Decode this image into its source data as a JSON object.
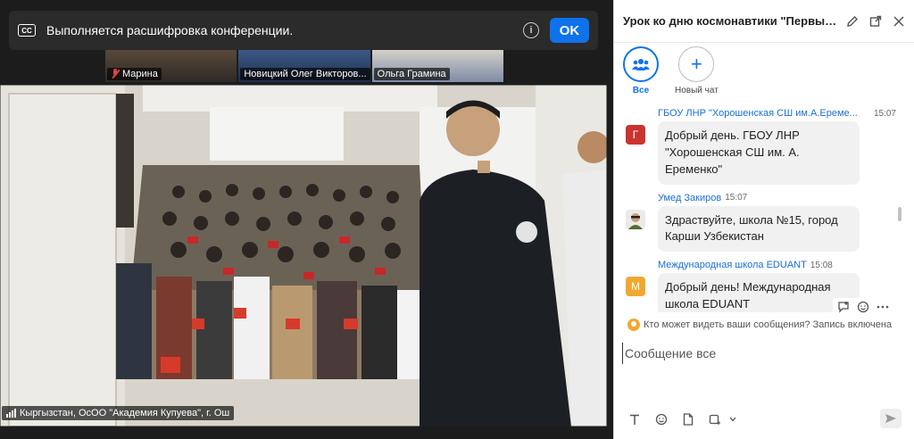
{
  "banner": {
    "text": "Выполняется расшифровка конференции.",
    "ok_label": "OK",
    "cc_label": "CC"
  },
  "thumbnails": [
    {
      "name": "Марина",
      "muted": true
    },
    {
      "name": "Новицкий Олег Викторов...",
      "muted": false
    },
    {
      "name": "Ольга Грамина",
      "muted": false
    }
  ],
  "video": {
    "label": "Кыргызстан, ОсОО \"Академия Купуева\", г. Ош"
  },
  "chat": {
    "title": "Урок ко дню космонавтики \"Первые в...",
    "tabs": [
      {
        "label": "Все",
        "active": true
      },
      {
        "label": "Новый чат",
        "active": false
      }
    ],
    "messages": [
      {
        "sender": "ГБОУ ЛНР \"Хорошенская СШ им.А.Ереме...",
        "time": "15:07",
        "avatar_letter": "Г",
        "avatar_color": "#c9352e",
        "text": "Добрый день. ГБОУ ЛНР \"Хорошенская СШ им. А. Еременко\""
      },
      {
        "sender": "Умед Закиров",
        "time": "15:07",
        "avatar_letter": "",
        "avatar_color": "#e6e6e6",
        "text": "Здраствуйте, школа №15, город Карши Узбекистан"
      },
      {
        "sender": "Международная школа EDUANT",
        "time": "15:08",
        "avatar_letter": "M",
        "avatar_color": "#f0a830",
        "text": "Добрый день! Международная школа EDUANT"
      }
    ],
    "privacy_text": "Кто может видеть ваши сообщения? Запись включена",
    "composer_placeholder": "Сообщение все"
  }
}
